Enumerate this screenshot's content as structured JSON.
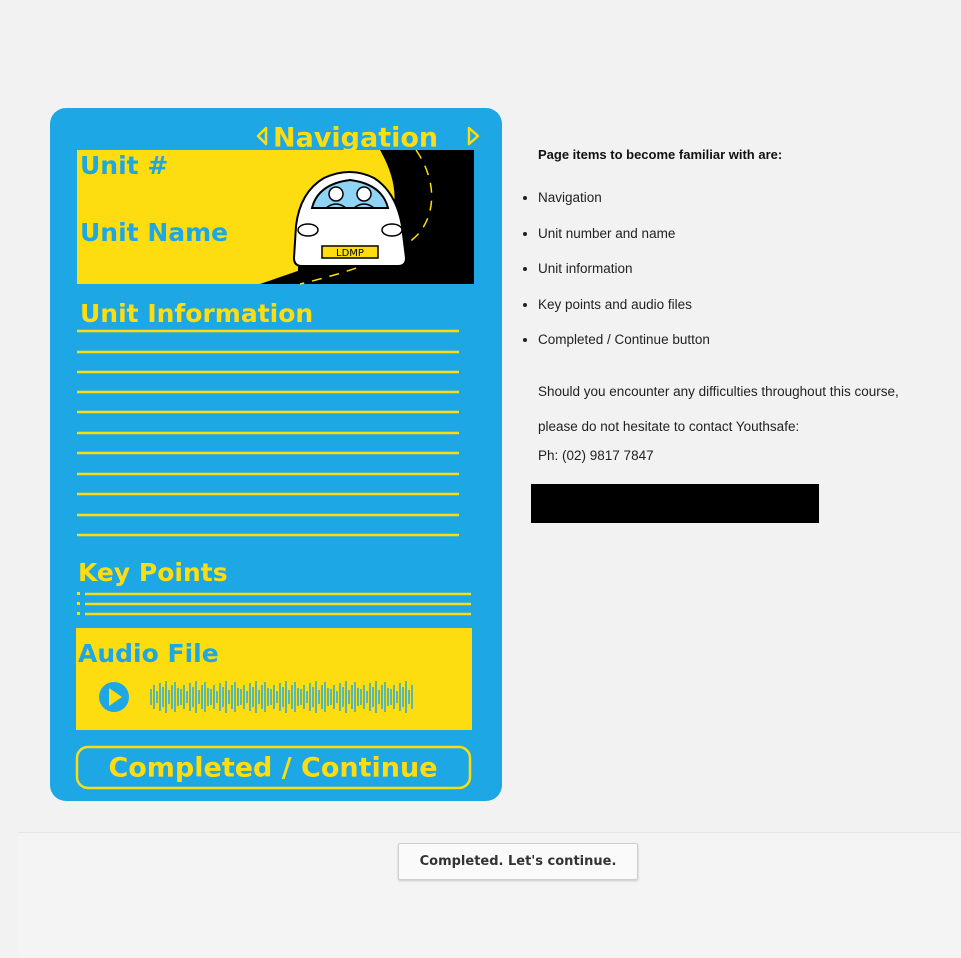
{
  "graphic": {
    "nav_label": "Navigation",
    "unit_number": "Unit #",
    "unit_name": "Unit Name",
    "plate": "LDMP",
    "unit_info": "Unit Information",
    "key_points": "Key Points",
    "audio_file": "Audio File",
    "completed_button": "Completed / Continue",
    "colors": {
      "blue": "#1da7e4",
      "yellow": "#fddd10",
      "road": "#000000"
    }
  },
  "info": {
    "heading": "Page items to become familiar with are:",
    "items": [
      "Navigation",
      "Unit number and name",
      "Unit information",
      "Key points and audio files",
      "Completed / Continue button"
    ],
    "contact_line1": "Should you encounter any difficulties throughout this course,",
    "contact_line2": "please do not hesitate to contact Youthsafe:",
    "phone": "Ph: (02) 9817 7847"
  },
  "footer": {
    "continue_label": "Completed. Let's continue."
  }
}
